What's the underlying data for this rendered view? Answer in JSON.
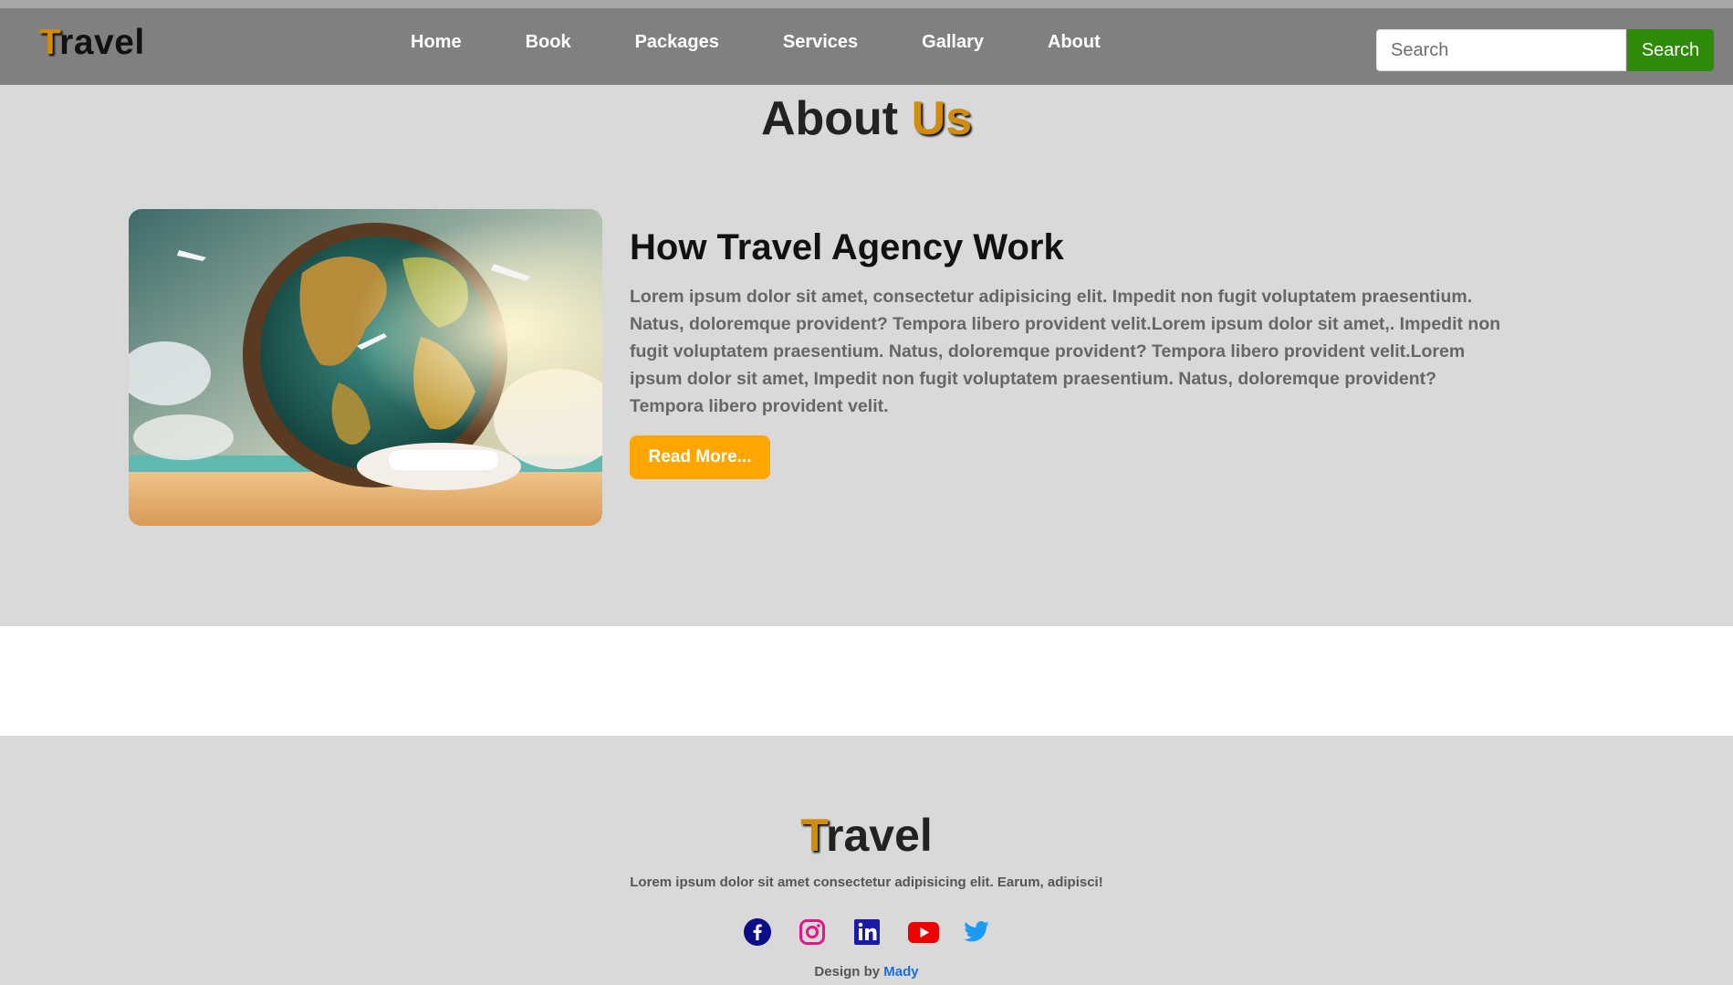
{
  "header": {
    "brand_first": "T",
    "brand_rest": "ravel",
    "nav": [
      {
        "label": "Home"
      },
      {
        "label": "Book"
      },
      {
        "label": "Packages"
      },
      {
        "label": "Services"
      },
      {
        "label": "Gallary"
      },
      {
        "label": "About"
      }
    ],
    "search": {
      "placeholder": "Search",
      "value": "",
      "button_label": "Search"
    }
  },
  "about": {
    "title_main": "About ",
    "title_accent": "Us",
    "heading": "How Travel Agency Work",
    "paragraph": "Lorem ipsum dolor sit amet, consectetur adipisicing elit. Impedit non fugit voluptatem praesentium. Natus, doloremque provident? Tempora libero provident velit.Lorem ipsum dolor sit amet,. Impedit non fugit voluptatem praesentium. Natus, doloremque provident? Tempora libero provident velit.Lorem ipsum dolor sit amet, Impedit non fugit voluptatem praesentium. Natus, doloremque provident? Tempora libero provident velit.",
    "read_more_label": "Read More...",
    "image_icon": "globe-with-airplanes-illustration"
  },
  "footer": {
    "brand_first": "T",
    "brand_rest": "ravel",
    "tagline": "Lorem ipsum dolor sit amet consectetur adipisicing elit. Earum, adipisci!",
    "social": [
      {
        "icon": "facebook-icon",
        "color": "#0d0d8a"
      },
      {
        "icon": "instagram-icon",
        "color": "#e0168a"
      },
      {
        "icon": "linkedin-icon",
        "color": "#1a1aa8"
      },
      {
        "icon": "youtube-icon",
        "color": "#ee0000"
      },
      {
        "icon": "twitter-icon",
        "color": "#1d9bf0"
      }
    ],
    "credit_prefix": "Design by ",
    "credit_author": "Mady"
  },
  "colors": {
    "navbar": "#808080",
    "accent": "#d18c0c",
    "search_button": "#2e8b0a",
    "read_more": "#ffa500",
    "section_bg": "#d9d9d9"
  }
}
